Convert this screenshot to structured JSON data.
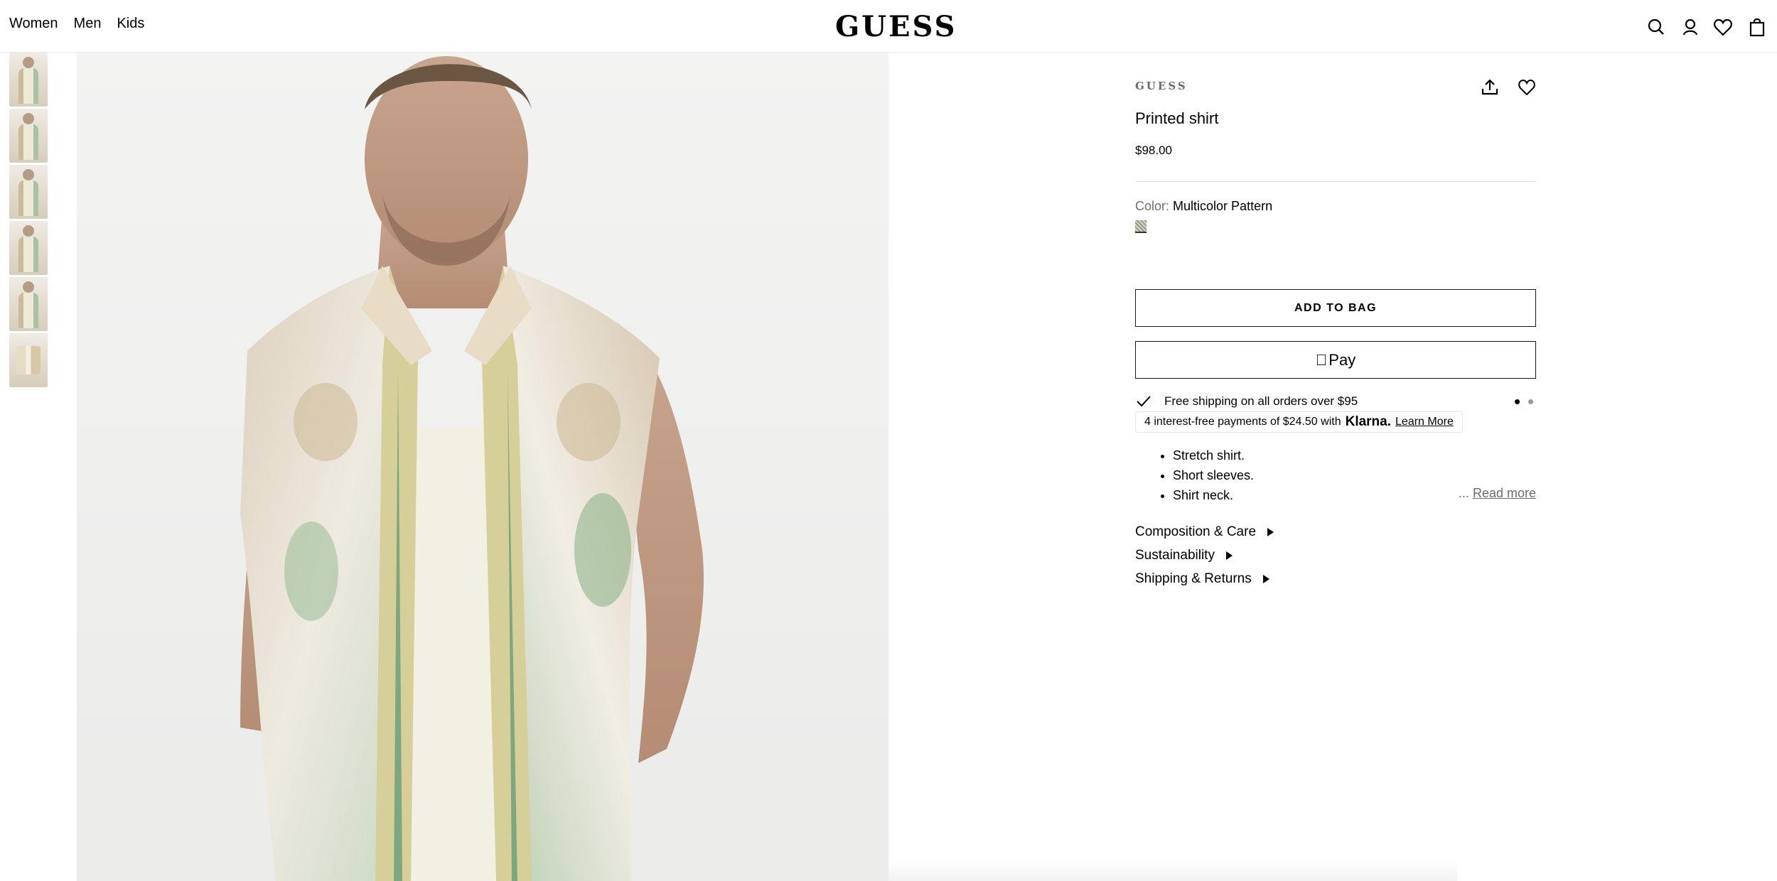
{
  "header": {
    "nav": [
      "Women",
      "Men",
      "Kids"
    ],
    "logo": "GUESS",
    "icons": [
      "search-icon",
      "account-icon",
      "wishlist-icon",
      "bag-icon"
    ]
  },
  "gallery": {
    "thumbnail_count": 6
  },
  "product": {
    "brand": "GUESS",
    "name": "Printed shirt",
    "price": "$98.00",
    "color_label": "Color:",
    "color_value": "Multicolor Pattern",
    "add_to_bag": "ADD TO BAG",
    "apple_pay": "Pay",
    "shipping": "Free shipping on all orders over $95",
    "klarna": {
      "text": "4 interest-free payments of $24.50 with",
      "brand": "Klarna.",
      "link": "Learn More"
    },
    "bullets": [
      "Stretch shirt.",
      "Short sleeves.",
      "Shirt neck."
    ],
    "read_more_prefix": "...",
    "read_more": "Read more",
    "accordions": [
      "Composition & Care",
      "Sustainability",
      "Shipping & Returns"
    ]
  }
}
